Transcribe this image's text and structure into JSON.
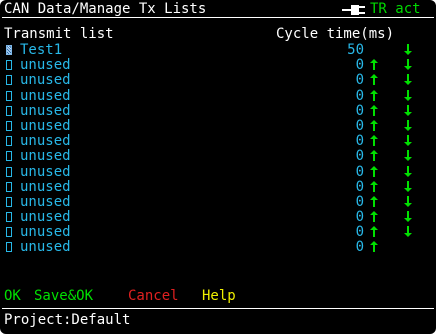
{
  "window": {
    "title": "CAN Data/Manage Tx Lists",
    "status": "TR act",
    "status_color": "#00d800",
    "status_icon": "plug-icon"
  },
  "header": {
    "left": "Transmit list",
    "right": "Cycle time(ms)"
  },
  "rows": [
    {
      "checked": true,
      "name": "Test1",
      "cycle": "50",
      "up": false,
      "down": true
    },
    {
      "checked": false,
      "name": "unused",
      "cycle": "0",
      "up": true,
      "down": true
    },
    {
      "checked": false,
      "name": "unused",
      "cycle": "0",
      "up": true,
      "down": true
    },
    {
      "checked": false,
      "name": "unused",
      "cycle": "0",
      "up": true,
      "down": true
    },
    {
      "checked": false,
      "name": "unused",
      "cycle": "0",
      "up": true,
      "down": true
    },
    {
      "checked": false,
      "name": "unused",
      "cycle": "0",
      "up": true,
      "down": true
    },
    {
      "checked": false,
      "name": "unused",
      "cycle": "0",
      "up": true,
      "down": true
    },
    {
      "checked": false,
      "name": "unused",
      "cycle": "0",
      "up": true,
      "down": true
    },
    {
      "checked": false,
      "name": "unused",
      "cycle": "0",
      "up": true,
      "down": true
    },
    {
      "checked": false,
      "name": "unused",
      "cycle": "0",
      "up": true,
      "down": true
    },
    {
      "checked": false,
      "name": "unused",
      "cycle": "0",
      "up": true,
      "down": true
    },
    {
      "checked": false,
      "name": "unused",
      "cycle": "0",
      "up": true,
      "down": true
    },
    {
      "checked": false,
      "name": "unused",
      "cycle": "0",
      "up": true,
      "down": true
    },
    {
      "checked": false,
      "name": "unused",
      "cycle": "0",
      "up": true,
      "down": false
    }
  ],
  "buttons": {
    "ok": "OK",
    "save_ok": "Save&OK",
    "cancel": "Cancel",
    "help": "Help"
  },
  "footer": {
    "project": "Project:Default"
  },
  "colors": {
    "background": "#000000",
    "text": "#ffffff",
    "list_text": "#28b8e8",
    "arrow": "#00e000",
    "ok": "#00e000",
    "cancel": "#e02020",
    "help": "#f0f000"
  }
}
